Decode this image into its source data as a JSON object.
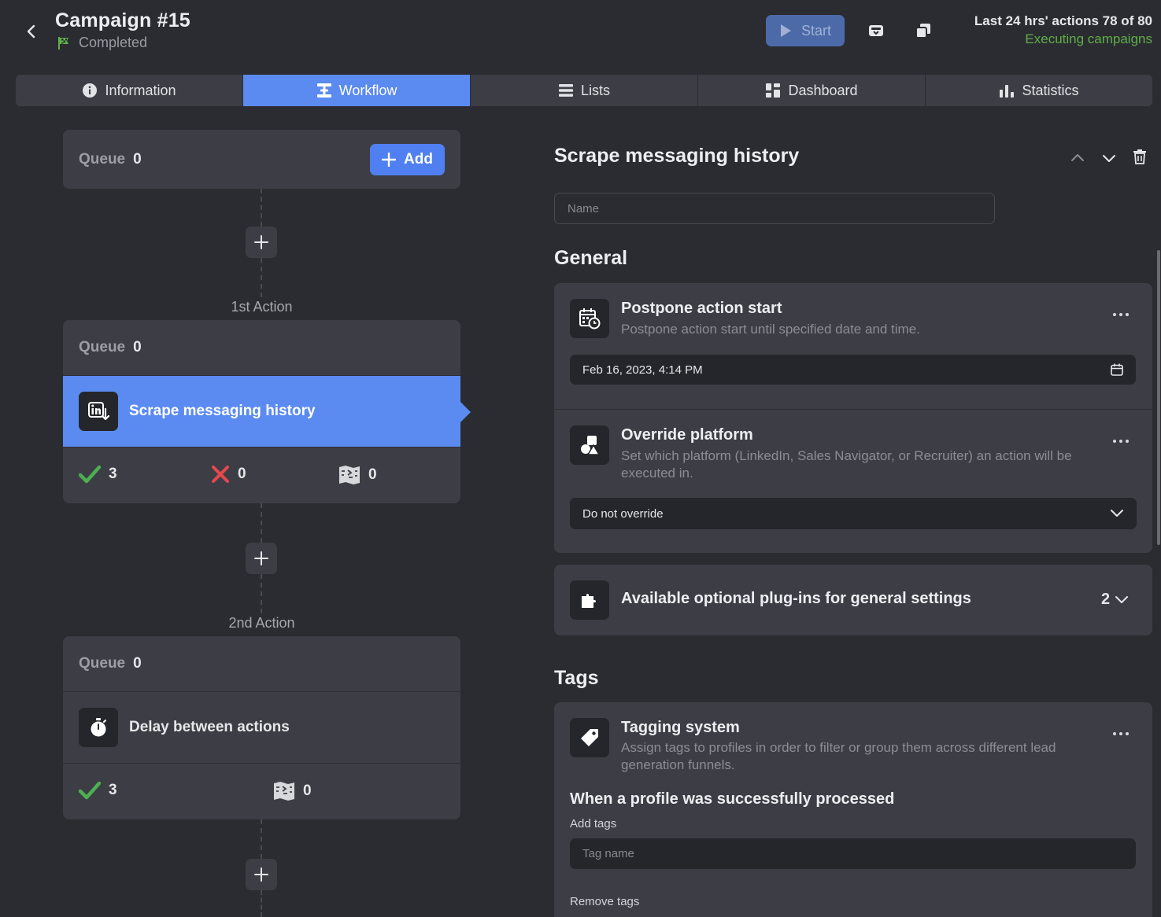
{
  "header": {
    "title": "Campaign #15",
    "status": "Completed",
    "start_label": "Start",
    "actions_count": "Last 24 hrs' actions 78 of 80",
    "executing_link": "Executing campaigns"
  },
  "tabs": [
    {
      "label": "Information",
      "icon": "info-icon"
    },
    {
      "label": "Workflow",
      "icon": "workflow-icon",
      "active": true
    },
    {
      "label": "Lists",
      "icon": "list-icon"
    },
    {
      "label": "Dashboard",
      "icon": "dashboard-icon"
    },
    {
      "label": "Statistics",
      "icon": "bar-chart-icon"
    }
  ],
  "workflow": {
    "top_queue": {
      "label": "Queue",
      "count": "0",
      "add_label": "Add"
    },
    "actions": [
      {
        "heading": "1st Action",
        "queue_label": "Queue",
        "queue_count": "0",
        "name": "Scrape messaging history",
        "icon": "scrape-linkedin-icon",
        "success": "3",
        "failed": "0",
        "skipped": "0"
      },
      {
        "heading": "2nd Action",
        "queue_label": "Queue",
        "queue_count": "0",
        "name": "Delay between actions",
        "icon": "stopwatch-icon",
        "success": "3",
        "skipped": "0"
      }
    ]
  },
  "details": {
    "title": "Scrape messaging history",
    "name_placeholder": "Name",
    "general_title": "General",
    "postpone": {
      "title": "Postpone action start",
      "description": "Postpone action start until specified date and time.",
      "value": "Feb 16, 2023, 4:14 PM"
    },
    "override": {
      "title": "Override platform",
      "description": "Set which platform (LinkedIn, Sales Navigator, or Recruiter) an action will be executed in.",
      "value": "Do not override"
    },
    "plugins": {
      "title": "Available optional plug-ins for general settings",
      "count": "2"
    },
    "tags_title": "Tags",
    "tagging": {
      "title": "Tagging system",
      "description": "Assign tags to profiles in order to filter or group them across different lead generation funnels.",
      "success_heading": "When a profile was successfully processed",
      "add_tags_label": "Add tags",
      "tag_placeholder": "Tag name",
      "remove_tags_label": "Remove tags"
    }
  },
  "colors": {
    "accent": "#5b8bf0",
    "success": "#4caf50",
    "error": "#e5484d",
    "executing": "#5fae4a"
  }
}
